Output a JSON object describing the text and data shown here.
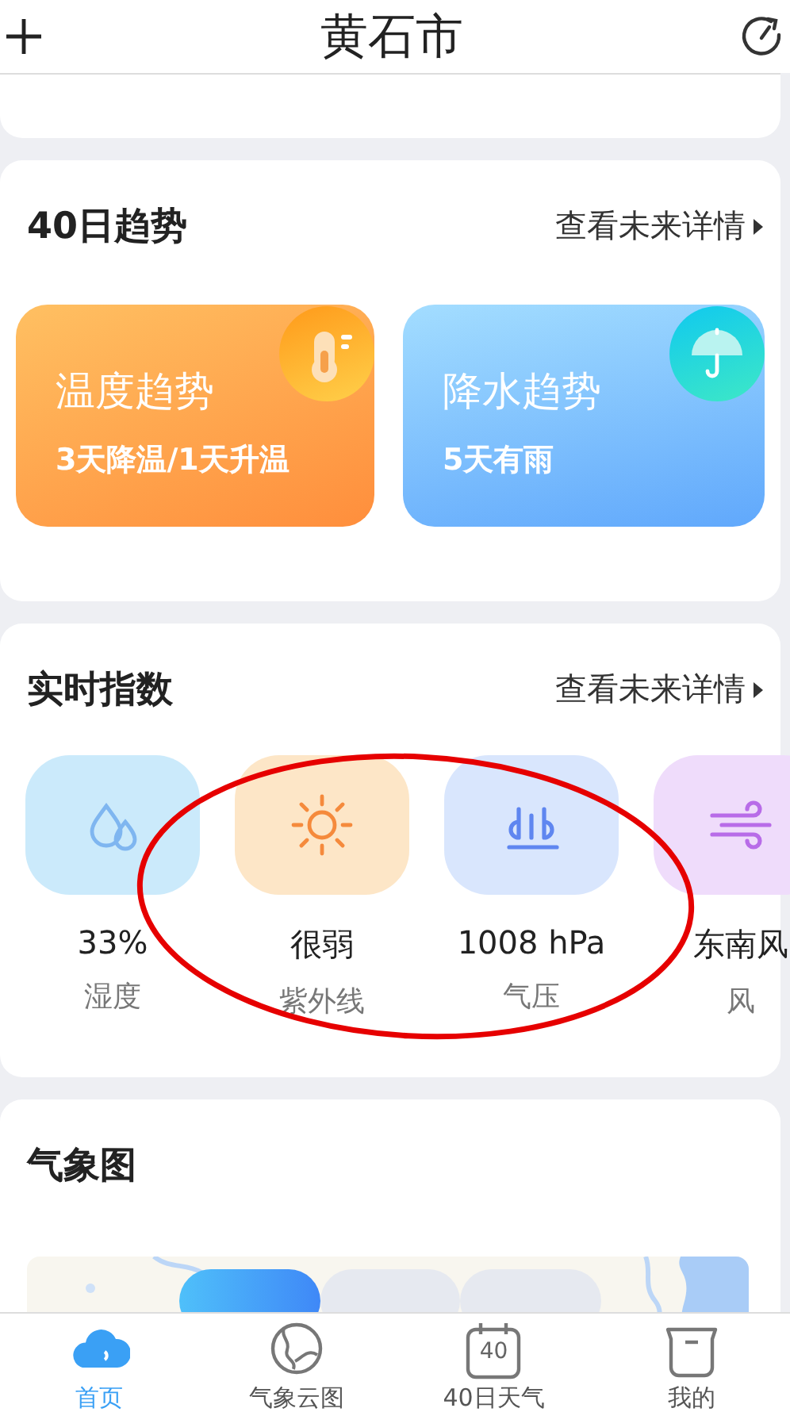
{
  "header": {
    "title": "黄石市"
  },
  "trend": {
    "title": "40日趋势",
    "more": "查看未来详情",
    "cards": [
      {
        "kind": "temperature",
        "title": "温度趋势",
        "summary": "3天降温/1天升温"
      },
      {
        "kind": "rain",
        "title": "降水趋势",
        "summary": "5天有雨"
      }
    ]
  },
  "indices": {
    "title": "实时指数",
    "more": "查看未来详情",
    "items": [
      {
        "kind": "humidity",
        "value": "33%",
        "label": "湿度"
      },
      {
        "kind": "uv",
        "value": "很弱",
        "label": "紫外线"
      },
      {
        "kind": "pressure",
        "value": "1008 hPa",
        "label": "气压"
      },
      {
        "kind": "wind",
        "value": "东南风",
        "label": "风"
      }
    ]
  },
  "annotation": {
    "kind": "ellipse"
  },
  "weather_map": {
    "title": "气象图",
    "layers": [
      {
        "selected": true
      },
      {
        "selected": false
      },
      {
        "selected": false
      }
    ]
  },
  "tab_bar": [
    {
      "kind": "home",
      "label": "首页",
      "selected": true
    },
    {
      "kind": "globe",
      "label": "气象云图",
      "selected": false
    },
    {
      "kind": "calendar",
      "label": "40日天气",
      "icon_text": "40",
      "selected": false
    },
    {
      "kind": "profile",
      "label": "我的",
      "selected": false
    }
  ]
}
